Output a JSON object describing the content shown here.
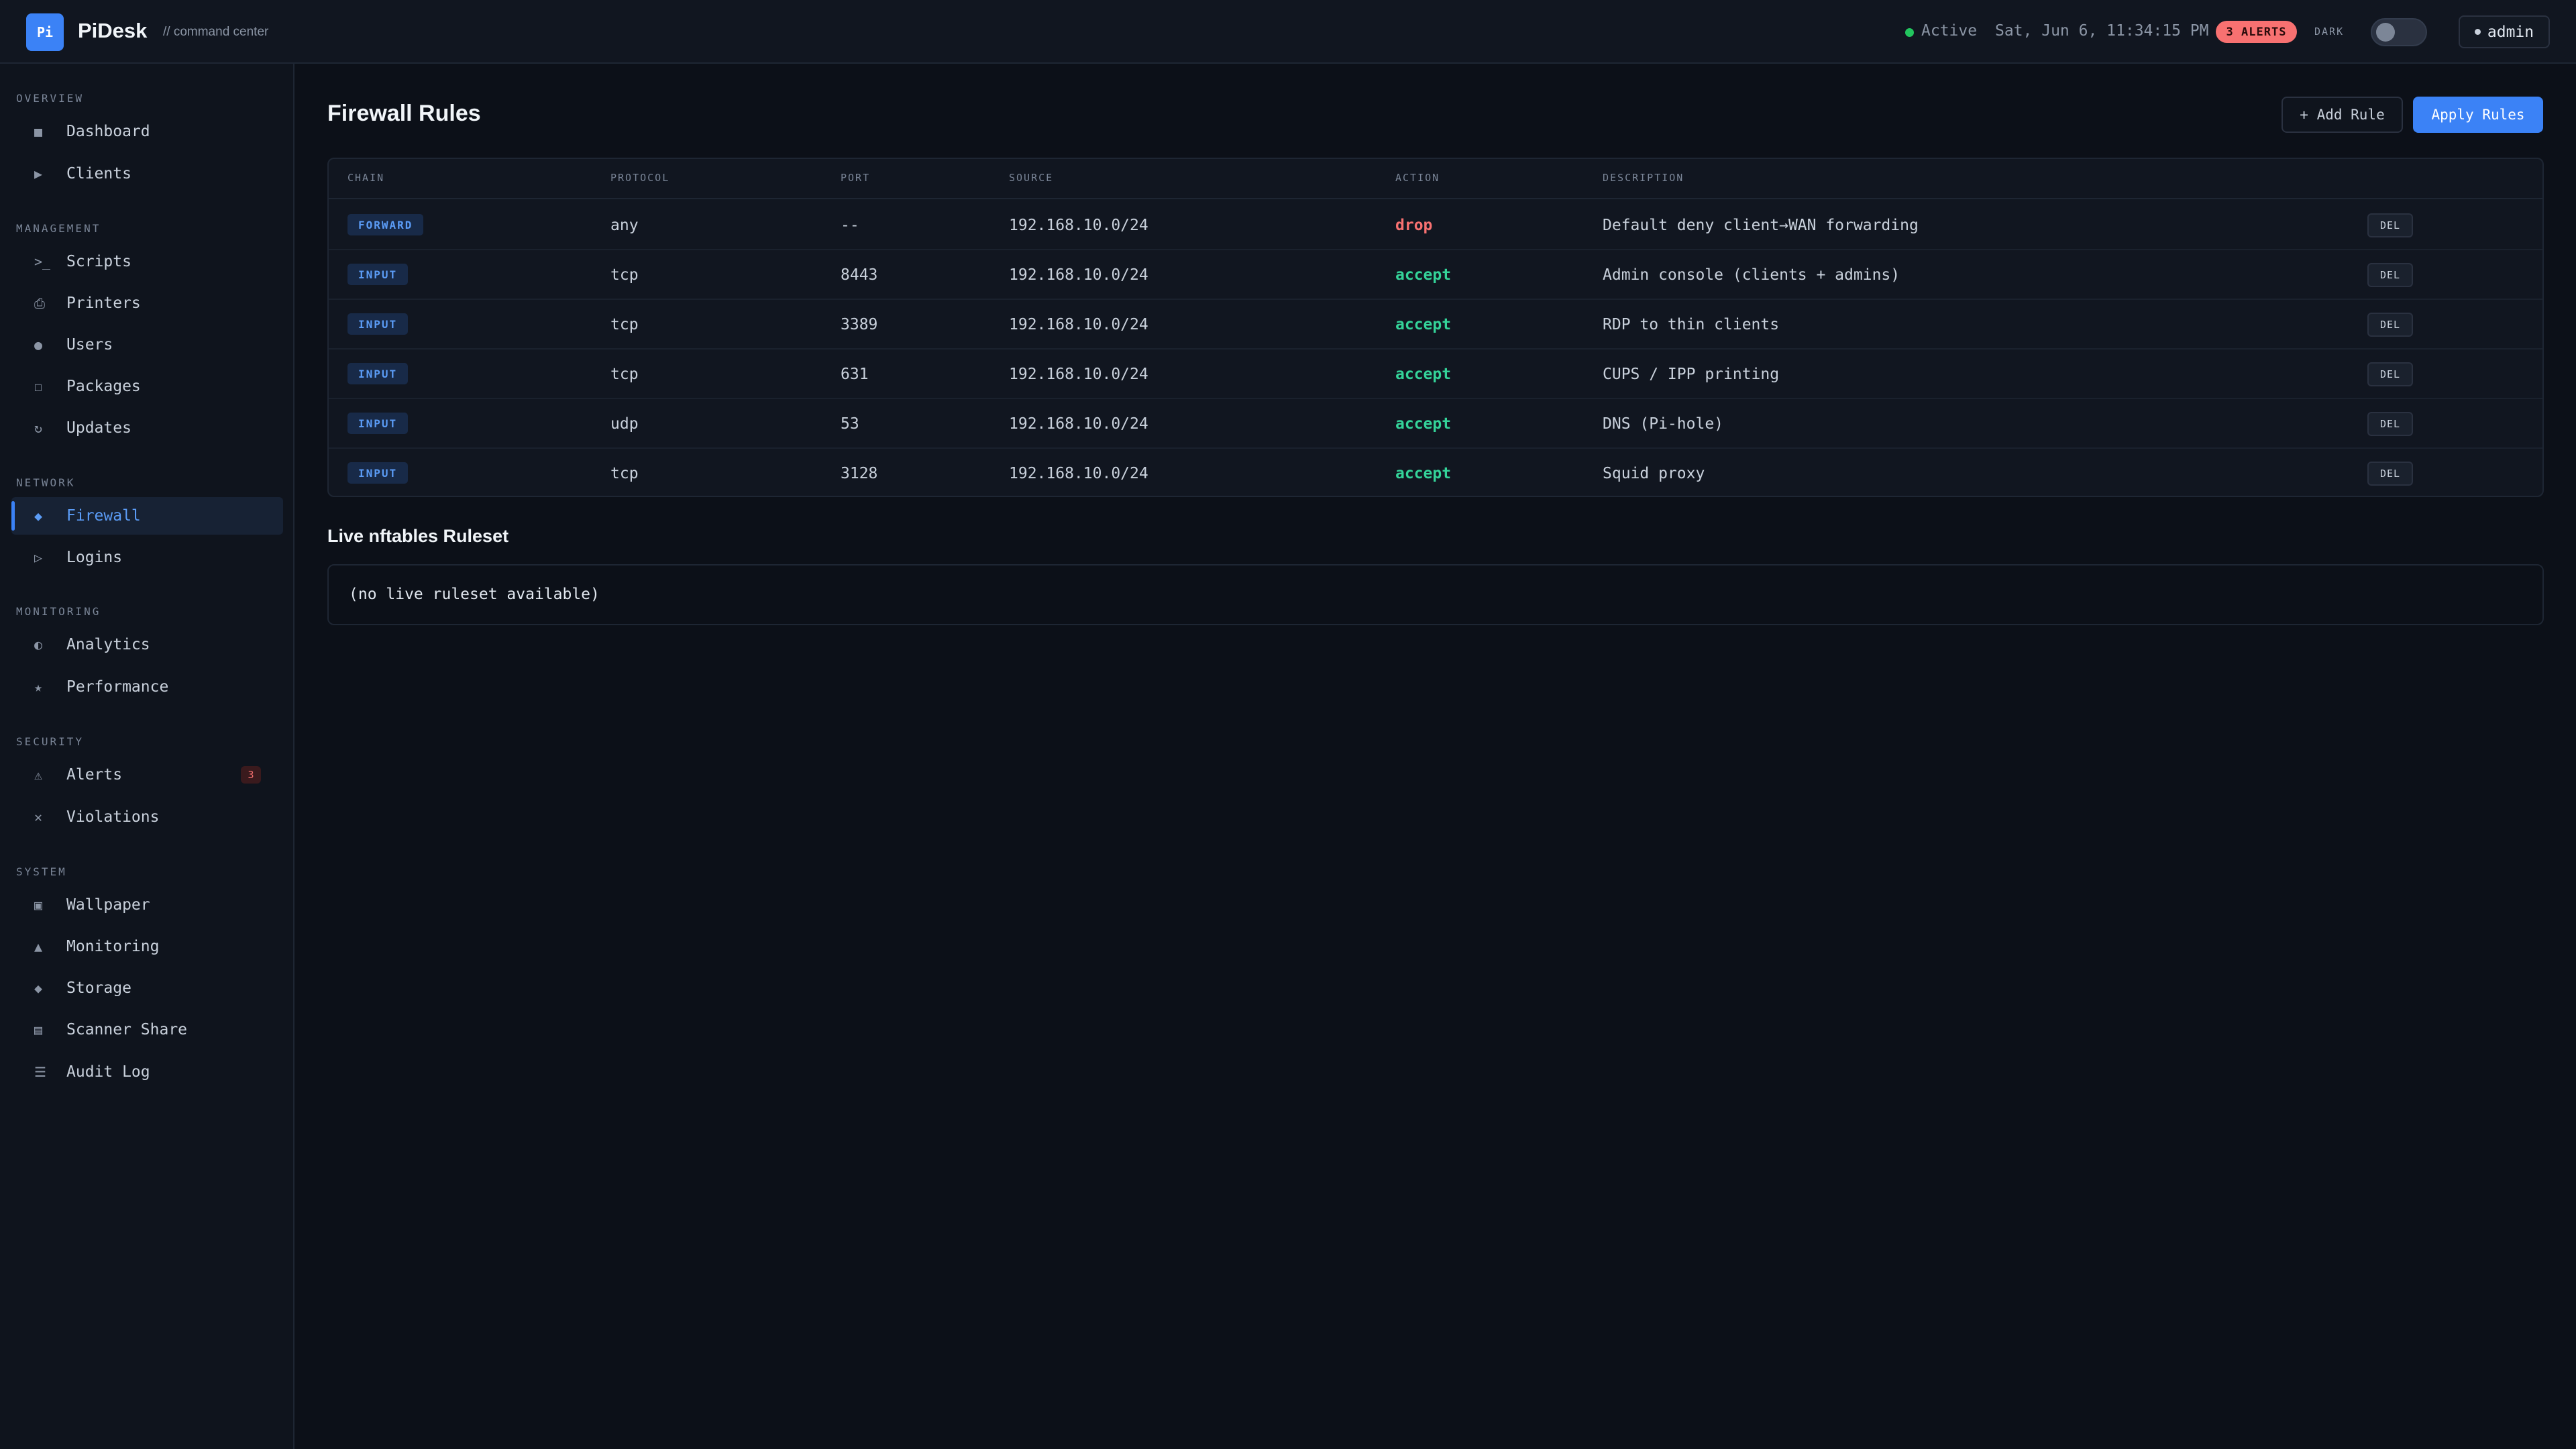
{
  "header": {
    "logo_text": "Pi",
    "brand": "PiDesk",
    "subtitle": "// command center",
    "status": "Active",
    "datetime": "Sat, Jun 6, 11:34:15 PM",
    "alerts": "3 ALERTS",
    "theme_label": "DARK",
    "user": "admin"
  },
  "sidebar": {
    "sections": {
      "overview": "OVERVIEW",
      "management": "MANAGEMENT",
      "network": "NETWORK",
      "monitoring": "MONITORING",
      "security": "SECURITY",
      "system": "SYSTEM"
    },
    "items": {
      "dashboard": {
        "label": "Dashboard",
        "icon": "■"
      },
      "clients": {
        "label": "Clients",
        "icon": "▶"
      },
      "scripts": {
        "label": "Scripts",
        "icon": ">_"
      },
      "printers": {
        "label": "Printers",
        "icon": "⎙"
      },
      "users": {
        "label": "Users",
        "icon": "●"
      },
      "packages": {
        "label": "Packages",
        "icon": "☐"
      },
      "updates": {
        "label": "Updates",
        "icon": "↻"
      },
      "firewall": {
        "label": "Firewall",
        "icon": "◆"
      },
      "logins": {
        "label": "Logins",
        "icon": "▷"
      },
      "analytics": {
        "label": "Analytics",
        "icon": "◐"
      },
      "performance": {
        "label": "Performance",
        "icon": "★"
      },
      "alerts": {
        "label": "Alerts",
        "icon": "⚠",
        "count": "3"
      },
      "violations": {
        "label": "Violations",
        "icon": "✕"
      },
      "wallpaper": {
        "label": "Wallpaper",
        "icon": "▣"
      },
      "monitoring": {
        "label": "Monitoring",
        "icon": "▲"
      },
      "storage": {
        "label": "Storage",
        "icon": "◆"
      },
      "scanner_share": {
        "label": "Scanner Share",
        "icon": "▤"
      },
      "audit_log": {
        "label": "Audit Log",
        "icon": "☰"
      }
    }
  },
  "main": {
    "title": "Firewall Rules",
    "add_rule": "+ Add Rule",
    "apply_rules": "Apply Rules",
    "columns": {
      "chain": "CHAIN",
      "protocol": "PROTOCOL",
      "port": "PORT",
      "source": "SOURCE",
      "action": "ACTION",
      "description": "DESCRIPTION"
    },
    "rows": [
      {
        "chain": "FORWARD",
        "protocol": "any",
        "port": "--",
        "source": "192.168.10.0/24",
        "action": "drop",
        "description": "Default deny client→WAN forwarding",
        "del": "DEL"
      },
      {
        "chain": "INPUT",
        "protocol": "tcp",
        "port": "8443",
        "source": "192.168.10.0/24",
        "action": "accept",
        "description": "Admin console (clients + admins)",
        "del": "DEL"
      },
      {
        "chain": "INPUT",
        "protocol": "tcp",
        "port": "3389",
        "source": "192.168.10.0/24",
        "action": "accept",
        "description": "RDP to thin clients",
        "del": "DEL"
      },
      {
        "chain": "INPUT",
        "protocol": "tcp",
        "port": "631",
        "source": "192.168.10.0/24",
        "action": "accept",
        "description": "CUPS / IPP printing",
        "del": "DEL"
      },
      {
        "chain": "INPUT",
        "protocol": "udp",
        "port": "53",
        "source": "192.168.10.0/24",
        "action": "accept",
        "description": "DNS (Pi-hole)",
        "del": "DEL"
      },
      {
        "chain": "INPUT",
        "protocol": "tcp",
        "port": "3128",
        "source": "192.168.10.0/24",
        "action": "accept",
        "description": "Squid proxy",
        "del": "DEL"
      }
    ],
    "ruleset_title": "Live nftables Ruleset",
    "ruleset_text": "(no live ruleset available)"
  },
  "colors": {
    "accent": "#3b82f6",
    "drop": "#f87171",
    "accept": "#34d399",
    "status_active": "#22c55e"
  }
}
